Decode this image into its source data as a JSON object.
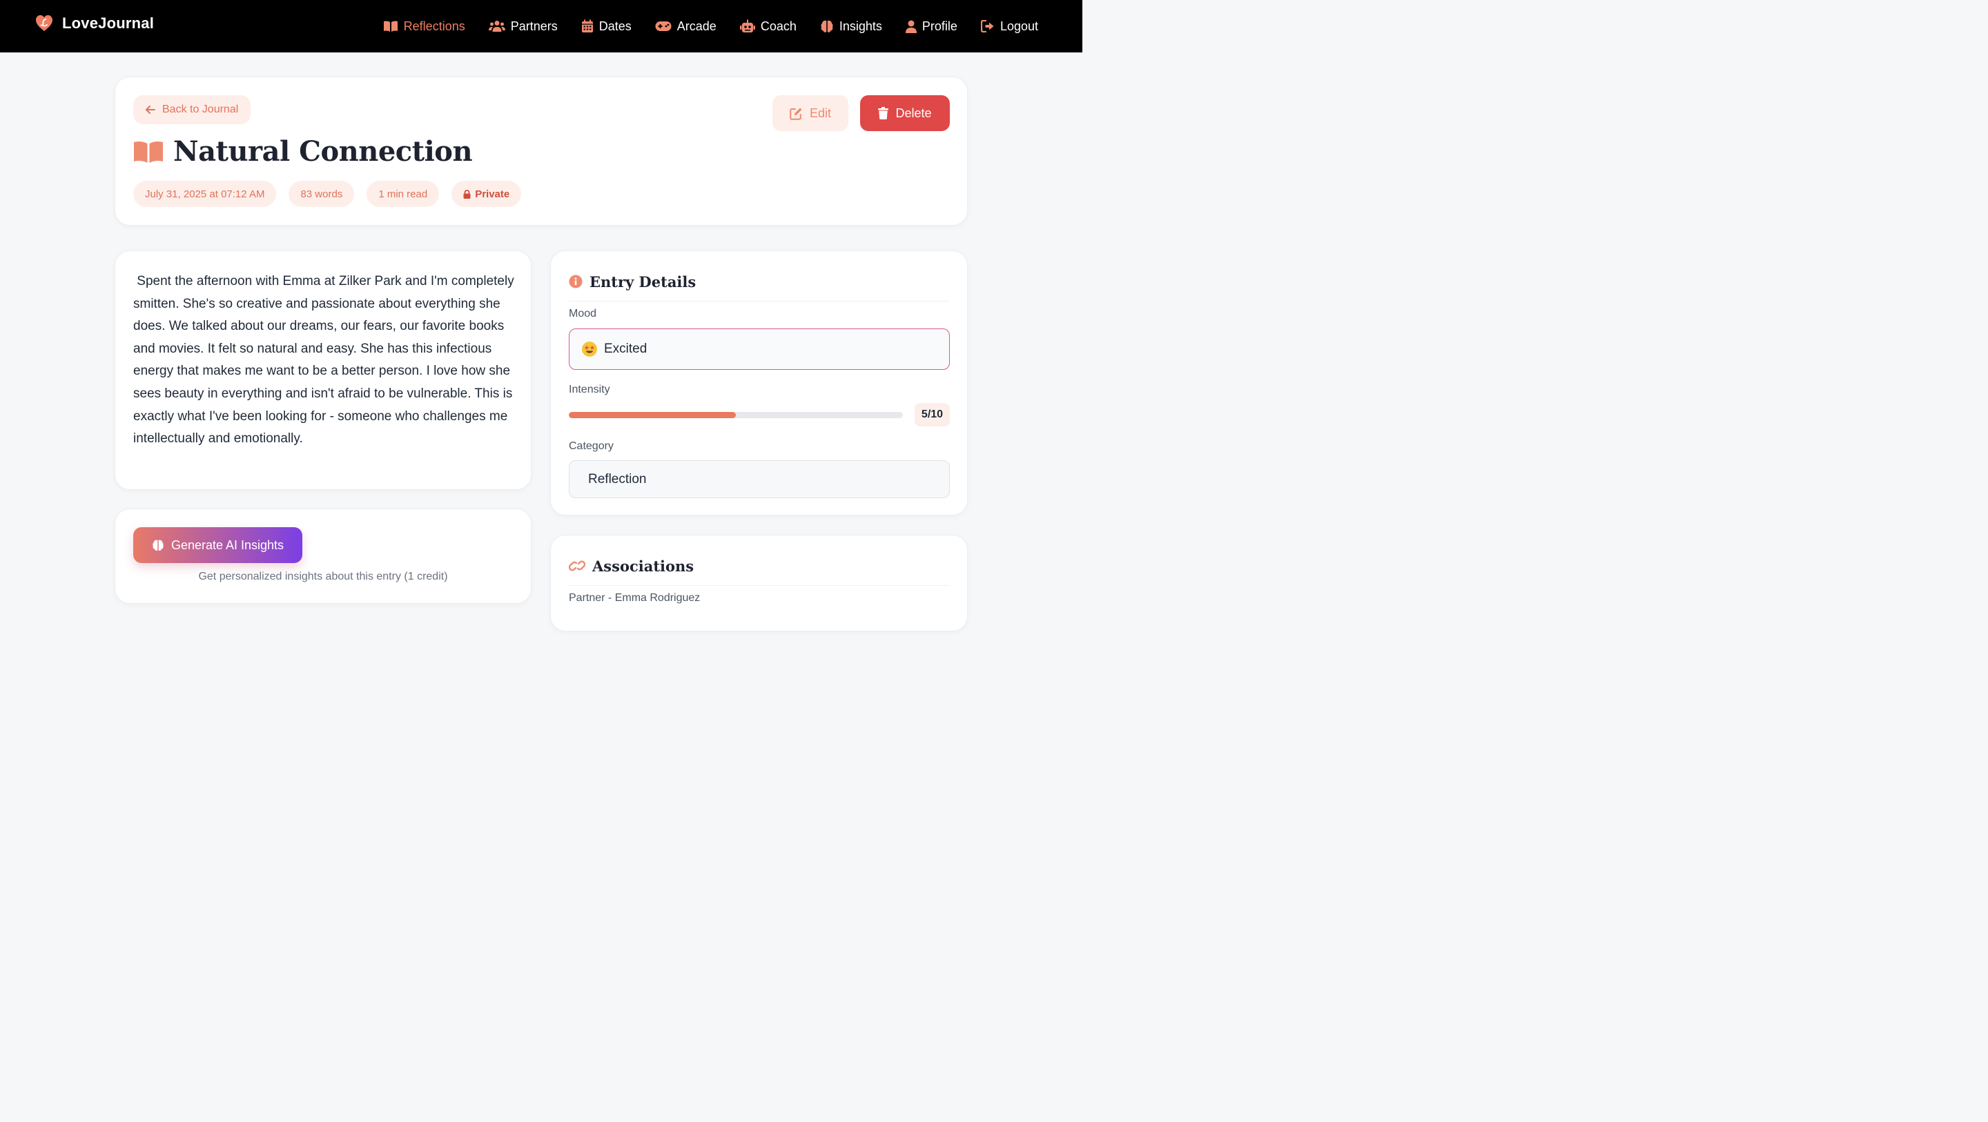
{
  "app": {
    "brand": "LoveJournal",
    "accent": "#ef7f63"
  },
  "nav": {
    "items": [
      {
        "label": "Reflections",
        "icon": "book-open-icon",
        "active": true
      },
      {
        "label": "Partners",
        "icon": "users-icon"
      },
      {
        "label": "Dates",
        "icon": "calendar-icon"
      },
      {
        "label": "Arcade",
        "icon": "gamepad-icon"
      },
      {
        "label": "Coach",
        "icon": "robot-icon"
      },
      {
        "label": "Insights",
        "icon": "brain-icon"
      },
      {
        "label": "Profile",
        "icon": "user-icon"
      },
      {
        "label": "Logout",
        "icon": "logout-icon"
      }
    ]
  },
  "header": {
    "back_label": "Back to Journal",
    "title": "Natural Connection",
    "edit_label": "Edit",
    "delete_label": "Delete",
    "meta": {
      "date": "July 31, 2025 at 07:12 AM",
      "words": "83 words",
      "read_time": "1 min read",
      "visibility": "Private"
    }
  },
  "entry": {
    "text": " Spent the afternoon with Emma at Zilker Park and I'm completely smitten. She's so creative and passionate about everything she does. We talked about our dreams, our fears, our favorite books and movies. It felt so natural and easy. She has this infectious energy that makes me want to be a better person. I love how she sees beauty in everything and isn't afraid to be vulnerable. This is exactly what I've been looking for - someone who challenges me intellectually and emotionally."
  },
  "ai": {
    "button_label": "Generate AI Insights",
    "note": "Get personalized insights about this entry (1 credit)"
  },
  "details": {
    "heading": "Entry Details",
    "mood_label": "Mood",
    "mood_value": "Excited",
    "mood_emoji": "🤩",
    "intensity_label": "Intensity",
    "intensity_value": "5/10",
    "intensity_fraction": 0.5,
    "category_label": "Category",
    "category_value": "Reflection"
  },
  "associations": {
    "heading": "Associations",
    "items": [
      "Partner - Emma Rodriguez"
    ]
  }
}
